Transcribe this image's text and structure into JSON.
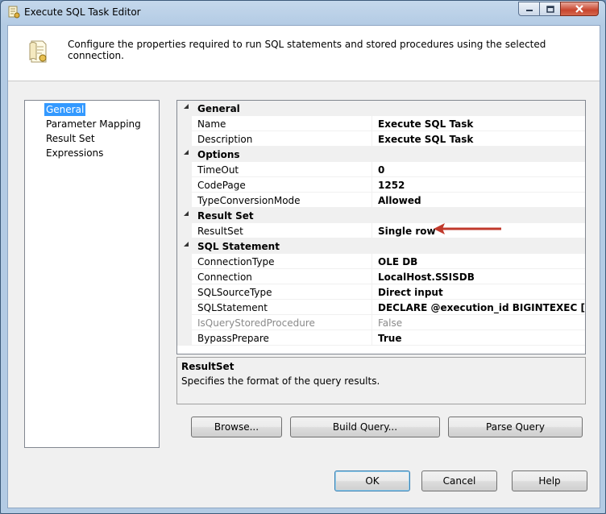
{
  "window": {
    "title": "Execute SQL Task Editor",
    "header_text": "Configure the properties required to run SQL statements and stored procedures using the selected connection."
  },
  "nav": {
    "items": [
      {
        "label": "General",
        "selected": true
      },
      {
        "label": "Parameter Mapping",
        "selected": false
      },
      {
        "label": "Result Set",
        "selected": false
      },
      {
        "label": "Expressions",
        "selected": false
      }
    ]
  },
  "grid": {
    "categories": [
      {
        "name": "General",
        "props": [
          {
            "name": "Name",
            "value": "Execute SQL Task"
          },
          {
            "name": "Description",
            "value": "Execute SQL Task"
          }
        ]
      },
      {
        "name": "Options",
        "props": [
          {
            "name": "TimeOut",
            "value": "0"
          },
          {
            "name": "CodePage",
            "value": "1252"
          },
          {
            "name": "TypeConversionMode",
            "value": "Allowed"
          }
        ]
      },
      {
        "name": "Result Set",
        "props": [
          {
            "name": "ResultSet",
            "value": "Single row"
          }
        ]
      },
      {
        "name": "SQL Statement",
        "props": [
          {
            "name": "ConnectionType",
            "value": "OLE DB"
          },
          {
            "name": "Connection",
            "value": "LocalHost.SSISDB"
          },
          {
            "name": "SQLSourceType",
            "value": "Direct input"
          },
          {
            "name": "SQLStatement",
            "value": "DECLARE @execution_id BIGINTEXEC [SSISDB].[c"
          },
          {
            "name": "IsQueryStoredProcedure",
            "value": "False",
            "disabled": true
          },
          {
            "name": "BypassPrepare",
            "value": "True"
          }
        ]
      }
    ]
  },
  "description": {
    "title": "ResultSet",
    "text": "Specifies the format of the query results."
  },
  "buttons": {
    "browse": "Browse...",
    "build_query": "Build Query...",
    "parse_query": "Parse Query",
    "ok": "OK",
    "cancel": "Cancel",
    "help": "Help"
  },
  "colors": {
    "accent_arrow": "#c0392b",
    "selection": "#3399ff"
  }
}
